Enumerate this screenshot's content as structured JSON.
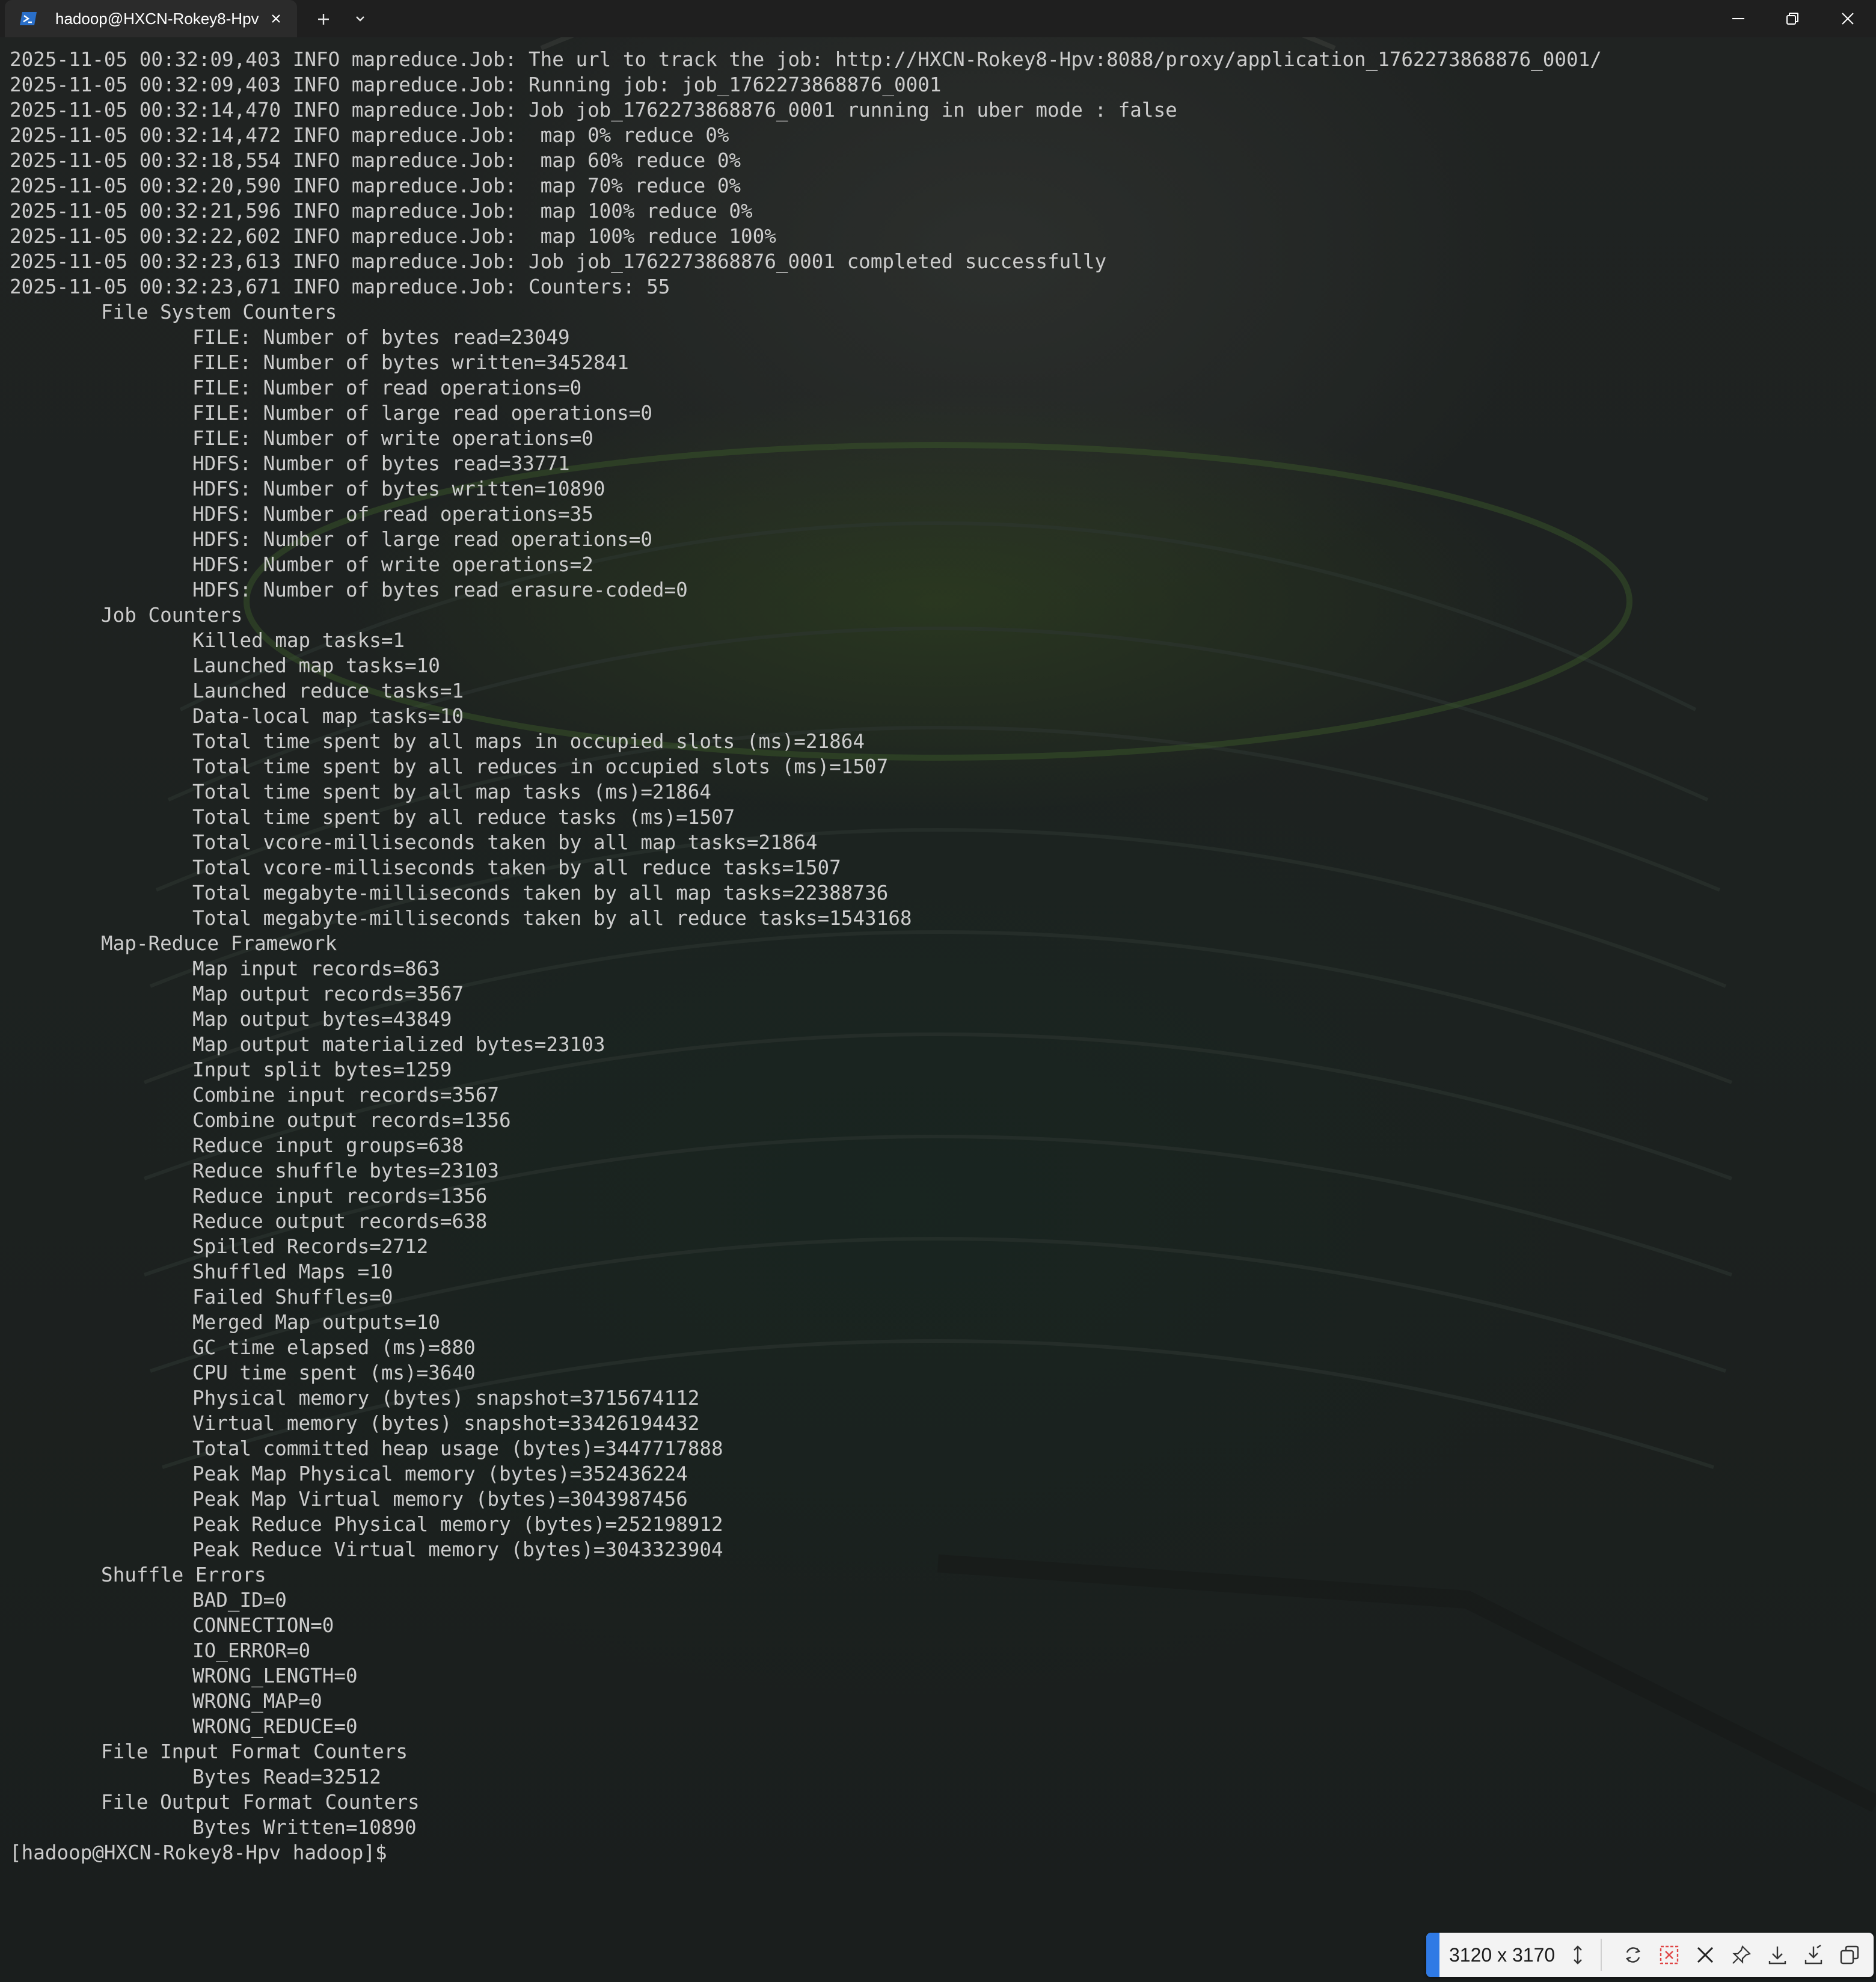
{
  "window": {
    "tab_title": "hadoop@HXCN-Rokey8-Hpv:~",
    "tab_icon": "powershell-icon",
    "new_tab_icon": "plus-icon",
    "dropdown_icon": "chevron-down-icon",
    "minimize_icon": "minimize-icon",
    "restore_icon": "restore-icon",
    "close_icon": "close-icon"
  },
  "terminal": {
    "lines": [
      {
        "indent": 0,
        "text": "2025-11-05 00:32:09,403 INFO mapreduce.Job: The url to track the job: http://HXCN-Rokey8-Hpv:8088/proxy/application_1762273868876_0001/"
      },
      {
        "indent": 0,
        "text": "2025-11-05 00:32:09,403 INFO mapreduce.Job: Running job: job_1762273868876_0001"
      },
      {
        "indent": 0,
        "text": "2025-11-05 00:32:14,470 INFO mapreduce.Job: Job job_1762273868876_0001 running in uber mode : false"
      },
      {
        "indent": 0,
        "text": "2025-11-05 00:32:14,472 INFO mapreduce.Job:  map 0% reduce 0%"
      },
      {
        "indent": 0,
        "text": "2025-11-05 00:32:18,554 INFO mapreduce.Job:  map 60% reduce 0%"
      },
      {
        "indent": 0,
        "text": "2025-11-05 00:32:20,590 INFO mapreduce.Job:  map 70% reduce 0%"
      },
      {
        "indent": 0,
        "text": "2025-11-05 00:32:21,596 INFO mapreduce.Job:  map 100% reduce 0%"
      },
      {
        "indent": 0,
        "text": "2025-11-05 00:32:22,602 INFO mapreduce.Job:  map 100% reduce 100%"
      },
      {
        "indent": 0,
        "text": "2025-11-05 00:32:23,613 INFO mapreduce.Job: Job job_1762273868876_0001 completed successfully"
      },
      {
        "indent": 0,
        "text": "2025-11-05 00:32:23,671 INFO mapreduce.Job: Counters: 55"
      },
      {
        "indent": 1,
        "text": "File System Counters"
      },
      {
        "indent": 2,
        "text": "FILE: Number of bytes read=23049"
      },
      {
        "indent": 2,
        "text": "FILE: Number of bytes written=3452841"
      },
      {
        "indent": 2,
        "text": "FILE: Number of read operations=0"
      },
      {
        "indent": 2,
        "text": "FILE: Number of large read operations=0"
      },
      {
        "indent": 2,
        "text": "FILE: Number of write operations=0"
      },
      {
        "indent": 2,
        "text": "HDFS: Number of bytes read=33771"
      },
      {
        "indent": 2,
        "text": "HDFS: Number of bytes written=10890"
      },
      {
        "indent": 2,
        "text": "HDFS: Number of read operations=35"
      },
      {
        "indent": 2,
        "text": "HDFS: Number of large read operations=0"
      },
      {
        "indent": 2,
        "text": "HDFS: Number of write operations=2"
      },
      {
        "indent": 2,
        "text": "HDFS: Number of bytes read erasure-coded=0"
      },
      {
        "indent": 1,
        "text": "Job Counters"
      },
      {
        "indent": 2,
        "text": "Killed map tasks=1"
      },
      {
        "indent": 2,
        "text": "Launched map tasks=10"
      },
      {
        "indent": 2,
        "text": "Launched reduce tasks=1"
      },
      {
        "indent": 2,
        "text": "Data-local map tasks=10"
      },
      {
        "indent": 2,
        "text": "Total time spent by all maps in occupied slots (ms)=21864"
      },
      {
        "indent": 2,
        "text": "Total time spent by all reduces in occupied slots (ms)=1507"
      },
      {
        "indent": 2,
        "text": "Total time spent by all map tasks (ms)=21864"
      },
      {
        "indent": 2,
        "text": "Total time spent by all reduce tasks (ms)=1507"
      },
      {
        "indent": 2,
        "text": "Total vcore-milliseconds taken by all map tasks=21864"
      },
      {
        "indent": 2,
        "text": "Total vcore-milliseconds taken by all reduce tasks=1507"
      },
      {
        "indent": 2,
        "text": "Total megabyte-milliseconds taken by all map tasks=22388736"
      },
      {
        "indent": 2,
        "text": "Total megabyte-milliseconds taken by all reduce tasks=1543168"
      },
      {
        "indent": 1,
        "text": "Map-Reduce Framework"
      },
      {
        "indent": 2,
        "text": "Map input records=863"
      },
      {
        "indent": 2,
        "text": "Map output records=3567"
      },
      {
        "indent": 2,
        "text": "Map output bytes=43849"
      },
      {
        "indent": 2,
        "text": "Map output materialized bytes=23103"
      },
      {
        "indent": 2,
        "text": "Input split bytes=1259"
      },
      {
        "indent": 2,
        "text": "Combine input records=3567"
      },
      {
        "indent": 2,
        "text": "Combine output records=1356"
      },
      {
        "indent": 2,
        "text": "Reduce input groups=638"
      },
      {
        "indent": 2,
        "text": "Reduce shuffle bytes=23103"
      },
      {
        "indent": 2,
        "text": "Reduce input records=1356"
      },
      {
        "indent": 2,
        "text": "Reduce output records=638"
      },
      {
        "indent": 2,
        "text": "Spilled Records=2712"
      },
      {
        "indent": 2,
        "text": "Shuffled Maps =10"
      },
      {
        "indent": 2,
        "text": "Failed Shuffles=0"
      },
      {
        "indent": 2,
        "text": "Merged Map outputs=10"
      },
      {
        "indent": 2,
        "text": "GC time elapsed (ms)=880"
      },
      {
        "indent": 2,
        "text": "CPU time spent (ms)=3640"
      },
      {
        "indent": 2,
        "text": "Physical memory (bytes) snapshot=3715674112"
      },
      {
        "indent": 2,
        "text": "Virtual memory (bytes) snapshot=33426194432"
      },
      {
        "indent": 2,
        "text": "Total committed heap usage (bytes)=3447717888"
      },
      {
        "indent": 2,
        "text": "Peak Map Physical memory (bytes)=352436224"
      },
      {
        "indent": 2,
        "text": "Peak Map Virtual memory (bytes)=3043987456"
      },
      {
        "indent": 2,
        "text": "Peak Reduce Physical memory (bytes)=252198912"
      },
      {
        "indent": 2,
        "text": "Peak Reduce Virtual memory (bytes)=3043323904"
      },
      {
        "indent": 1,
        "text": "Shuffle Errors"
      },
      {
        "indent": 2,
        "text": "BAD_ID=0"
      },
      {
        "indent": 2,
        "text": "CONNECTION=0"
      },
      {
        "indent": 2,
        "text": "IO_ERROR=0"
      },
      {
        "indent": 2,
        "text": "WRONG_LENGTH=0"
      },
      {
        "indent": 2,
        "text": "WRONG_MAP=0"
      },
      {
        "indent": 2,
        "text": "WRONG_REDUCE=0"
      },
      {
        "indent": 1,
        "text": "File Input Format Counters"
      },
      {
        "indent": 2,
        "text": "Bytes Read=32512"
      },
      {
        "indent": 1,
        "text": "File Output Format Counters"
      },
      {
        "indent": 2,
        "text": "Bytes Written=10890"
      },
      {
        "indent": 0,
        "text": "[hadoop@HXCN-Rokey8-Hpv hadoop]$ "
      }
    ]
  },
  "capture_toolbar": {
    "size_label": "3120 x 3170",
    "icons": [
      "resize-vertical-icon",
      "rotate-icon",
      "delete-icon",
      "close-icon",
      "pin-icon",
      "download-icon",
      "save-as-icon",
      "copy-icon"
    ],
    "accent_color": "#2f7ae5"
  }
}
